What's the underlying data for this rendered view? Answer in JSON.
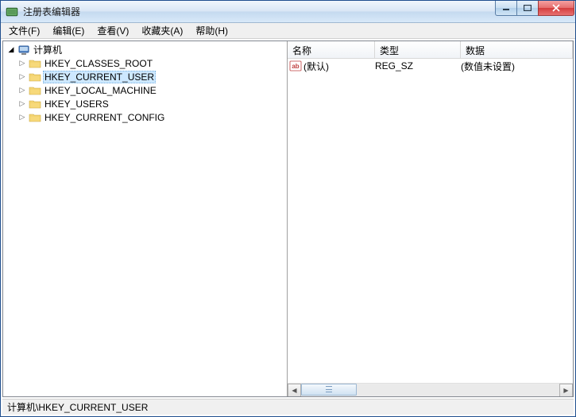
{
  "window": {
    "title": "注册表编辑器"
  },
  "menu": [
    "文件(F)",
    "编辑(E)",
    "查看(V)",
    "收藏夹(A)",
    "帮助(H)"
  ],
  "tree": {
    "root": {
      "label": "计算机",
      "expanded": true
    },
    "children": [
      {
        "label": "HKEY_CLASSES_ROOT",
        "selected": false
      },
      {
        "label": "HKEY_CURRENT_USER",
        "selected": true
      },
      {
        "label": "HKEY_LOCAL_MACHINE",
        "selected": false
      },
      {
        "label": "HKEY_USERS",
        "selected": false
      },
      {
        "label": "HKEY_CURRENT_CONFIG",
        "selected": false
      }
    ]
  },
  "columns": {
    "name": "名称",
    "type": "类型",
    "data": "数据"
  },
  "values": [
    {
      "name": "(默认)",
      "type": "REG_SZ",
      "data": "(数值未设置)",
      "icon": "string-value-icon"
    }
  ],
  "status": "计算机\\HKEY_CURRENT_USER"
}
